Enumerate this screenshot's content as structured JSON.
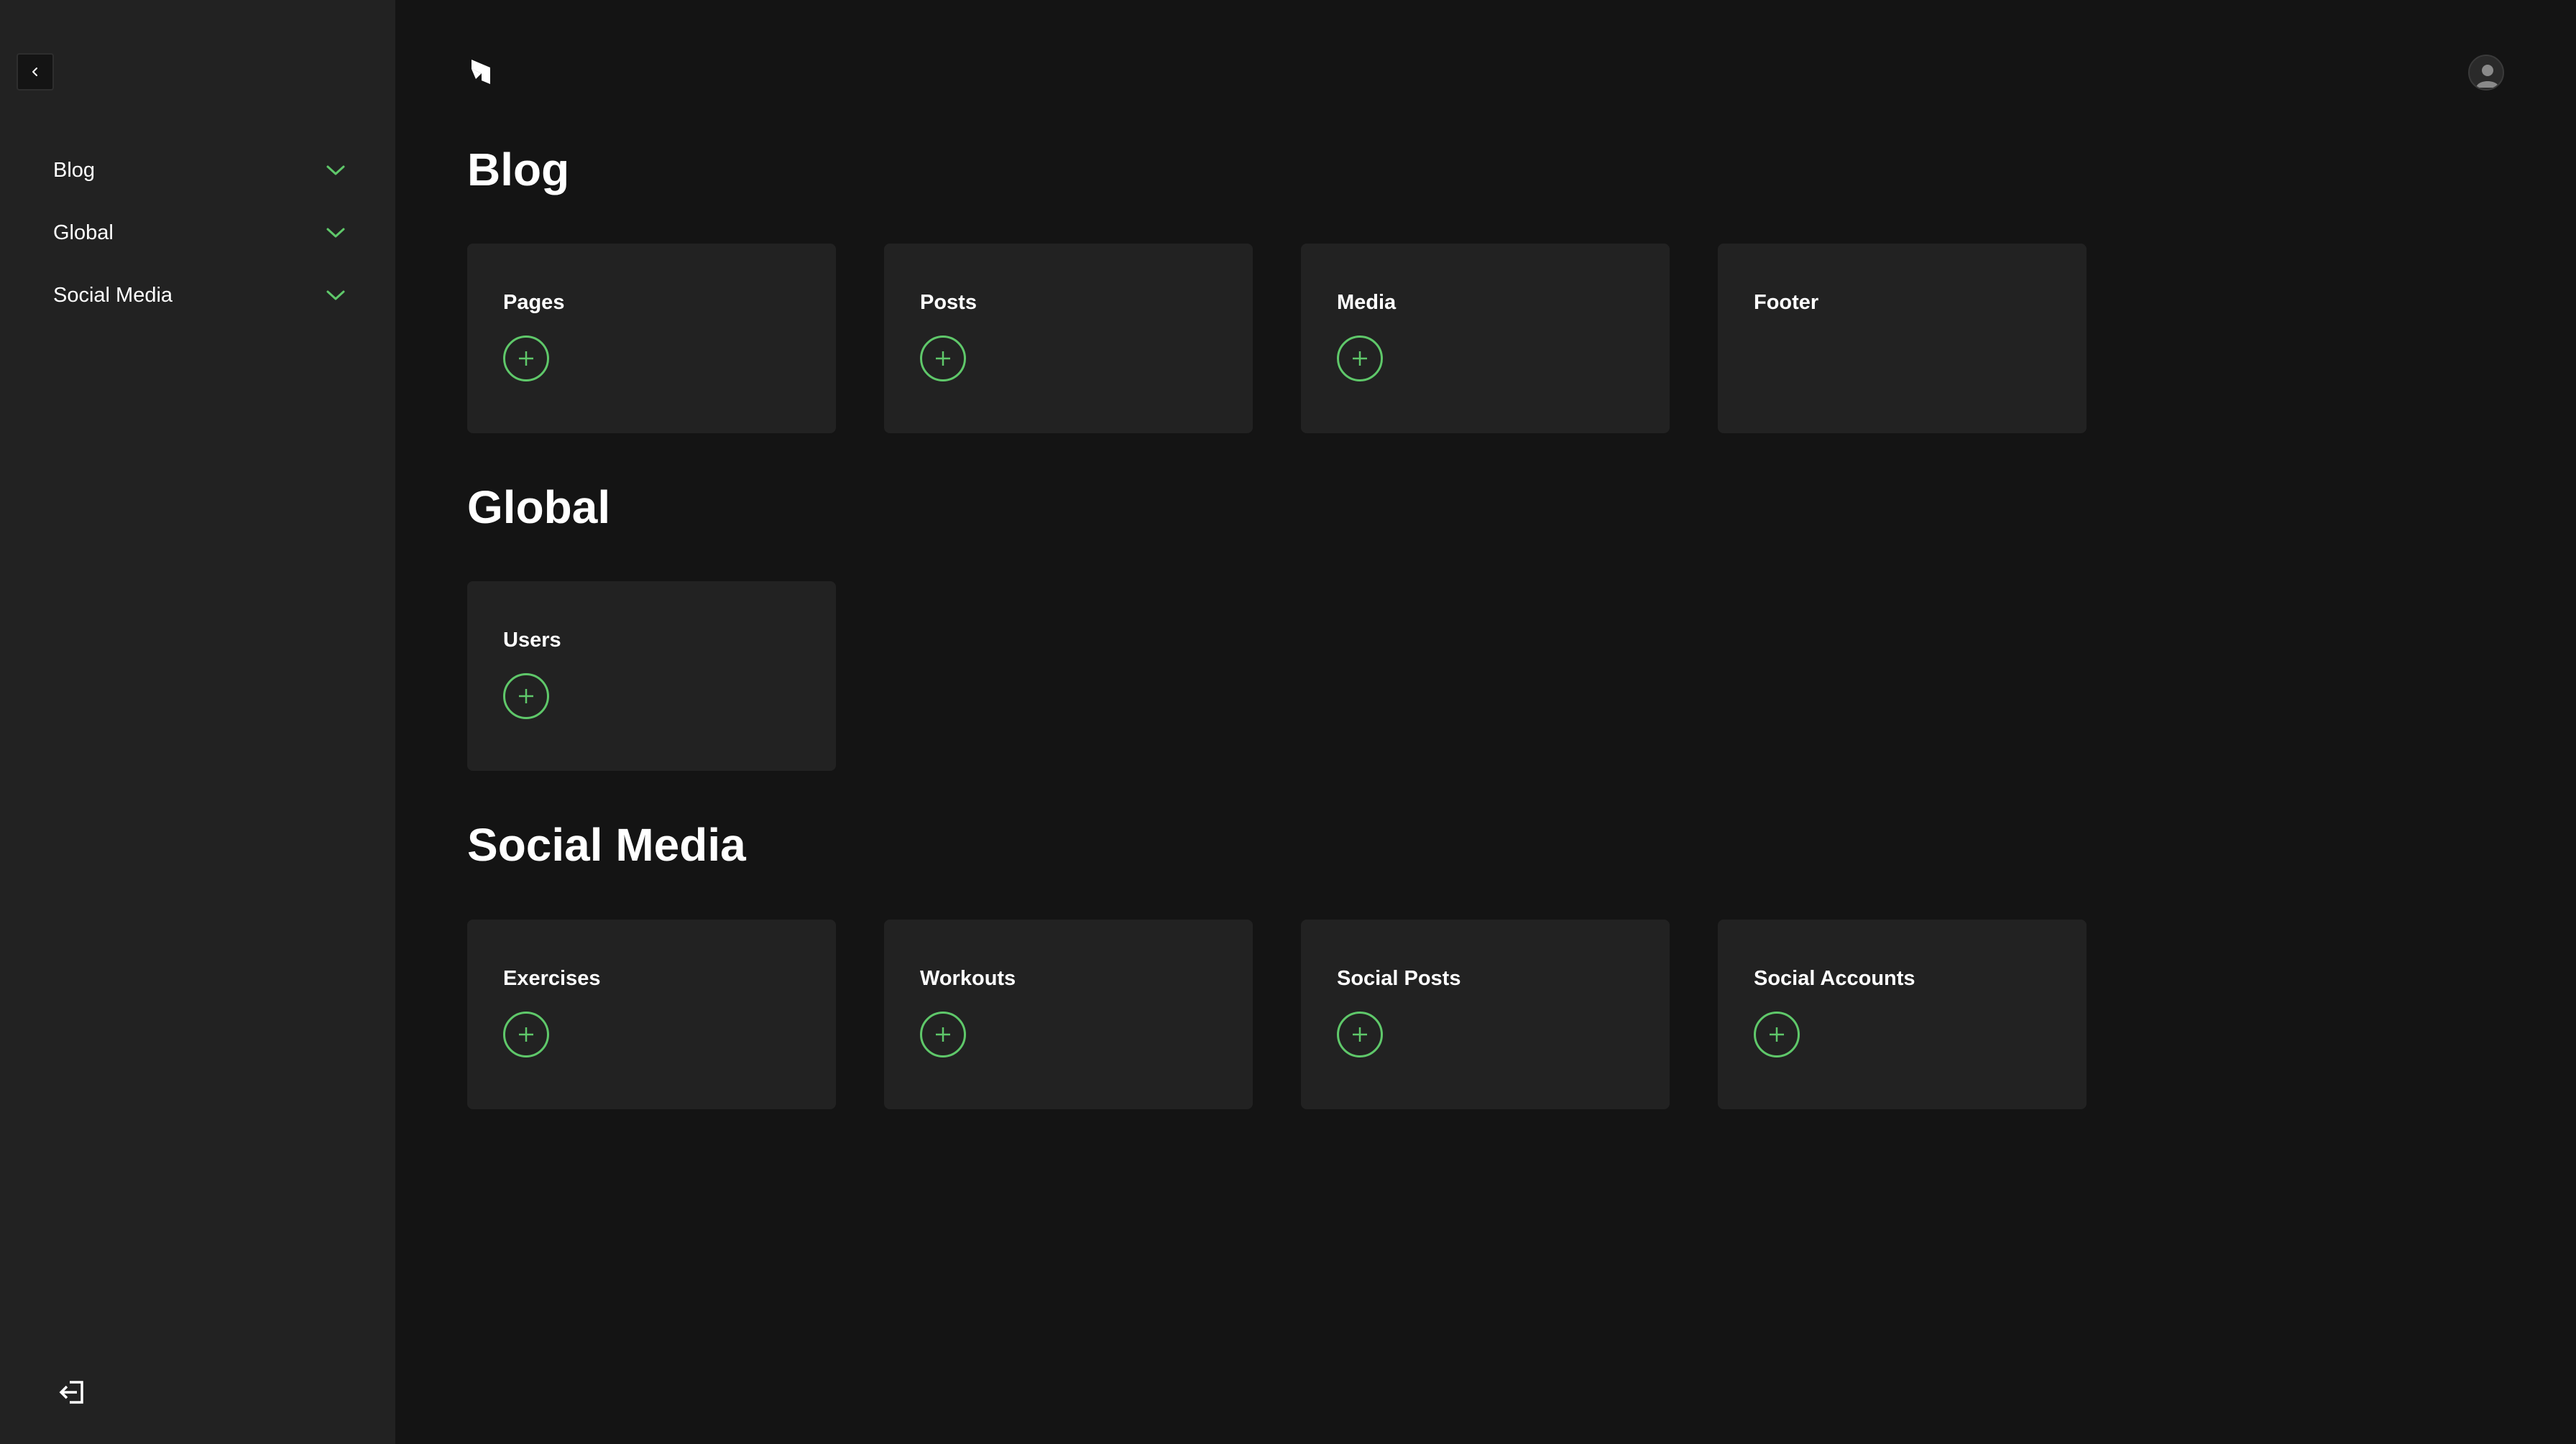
{
  "sidebar": {
    "groups": [
      {
        "label": "Blog"
      },
      {
        "label": "Global"
      },
      {
        "label": "Social Media"
      }
    ]
  },
  "sections": [
    {
      "title": "Blog",
      "cards": [
        {
          "label": "Pages",
          "has_add": true
        },
        {
          "label": "Posts",
          "has_add": true
        },
        {
          "label": "Media",
          "has_add": true
        },
        {
          "label": "Footer",
          "has_add": false
        }
      ]
    },
    {
      "title": "Global",
      "cards": [
        {
          "label": "Users",
          "has_add": true
        }
      ]
    },
    {
      "title": "Social Media",
      "cards": [
        {
          "label": "Exercises",
          "has_add": true
        },
        {
          "label": "Workouts",
          "has_add": true
        },
        {
          "label": "Social Posts",
          "has_add": true
        },
        {
          "label": "Social Accounts",
          "has_add": true
        }
      ]
    }
  ],
  "icons": {
    "collapse": "chevron-left-icon",
    "group_toggle": "chevron-down-icon",
    "add": "plus-circle-icon",
    "logout": "logout-icon",
    "logo": "logo-icon",
    "avatar": "user-avatar-icon"
  },
  "colors": {
    "accent": "#5fc86a",
    "background": "#141414",
    "panel": "#222222",
    "text": "#ffffff"
  }
}
